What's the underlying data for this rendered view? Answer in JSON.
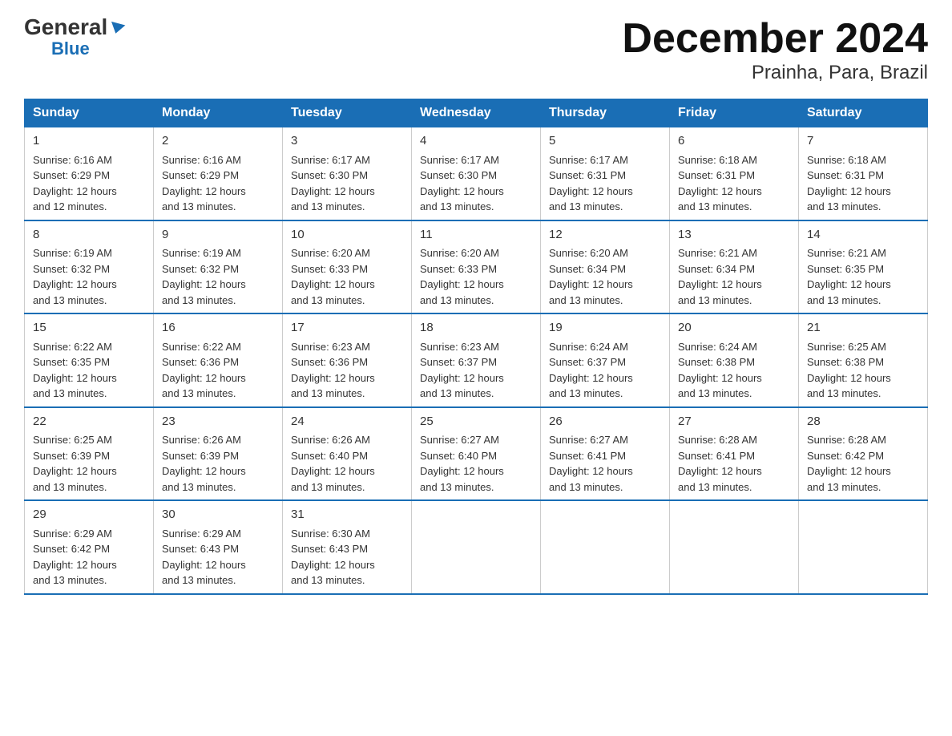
{
  "logo": {
    "general": "General",
    "blue": "Blue",
    "triangle": "▶"
  },
  "title": "December 2024",
  "subtitle": "Prainha, Para, Brazil",
  "weekdays": [
    "Sunday",
    "Monday",
    "Tuesday",
    "Wednesday",
    "Thursday",
    "Friday",
    "Saturday"
  ],
  "weeks": [
    [
      {
        "day": "1",
        "sunrise": "6:16 AM",
        "sunset": "6:29 PM",
        "daylight": "12 hours and 12 minutes."
      },
      {
        "day": "2",
        "sunrise": "6:16 AM",
        "sunset": "6:29 PM",
        "daylight": "12 hours and 13 minutes."
      },
      {
        "day": "3",
        "sunrise": "6:17 AM",
        "sunset": "6:30 PM",
        "daylight": "12 hours and 13 minutes."
      },
      {
        "day": "4",
        "sunrise": "6:17 AM",
        "sunset": "6:30 PM",
        "daylight": "12 hours and 13 minutes."
      },
      {
        "day": "5",
        "sunrise": "6:17 AM",
        "sunset": "6:31 PM",
        "daylight": "12 hours and 13 minutes."
      },
      {
        "day": "6",
        "sunrise": "6:18 AM",
        "sunset": "6:31 PM",
        "daylight": "12 hours and 13 minutes."
      },
      {
        "day": "7",
        "sunrise": "6:18 AM",
        "sunset": "6:31 PM",
        "daylight": "12 hours and 13 minutes."
      }
    ],
    [
      {
        "day": "8",
        "sunrise": "6:19 AM",
        "sunset": "6:32 PM",
        "daylight": "12 hours and 13 minutes."
      },
      {
        "day": "9",
        "sunrise": "6:19 AM",
        "sunset": "6:32 PM",
        "daylight": "12 hours and 13 minutes."
      },
      {
        "day": "10",
        "sunrise": "6:20 AM",
        "sunset": "6:33 PM",
        "daylight": "12 hours and 13 minutes."
      },
      {
        "day": "11",
        "sunrise": "6:20 AM",
        "sunset": "6:33 PM",
        "daylight": "12 hours and 13 minutes."
      },
      {
        "day": "12",
        "sunrise": "6:20 AM",
        "sunset": "6:34 PM",
        "daylight": "12 hours and 13 minutes."
      },
      {
        "day": "13",
        "sunrise": "6:21 AM",
        "sunset": "6:34 PM",
        "daylight": "12 hours and 13 minutes."
      },
      {
        "day": "14",
        "sunrise": "6:21 AM",
        "sunset": "6:35 PM",
        "daylight": "12 hours and 13 minutes."
      }
    ],
    [
      {
        "day": "15",
        "sunrise": "6:22 AM",
        "sunset": "6:35 PM",
        "daylight": "12 hours and 13 minutes."
      },
      {
        "day": "16",
        "sunrise": "6:22 AM",
        "sunset": "6:36 PM",
        "daylight": "12 hours and 13 minutes."
      },
      {
        "day": "17",
        "sunrise": "6:23 AM",
        "sunset": "6:36 PM",
        "daylight": "12 hours and 13 minutes."
      },
      {
        "day": "18",
        "sunrise": "6:23 AM",
        "sunset": "6:37 PM",
        "daylight": "12 hours and 13 minutes."
      },
      {
        "day": "19",
        "sunrise": "6:24 AM",
        "sunset": "6:37 PM",
        "daylight": "12 hours and 13 minutes."
      },
      {
        "day": "20",
        "sunrise": "6:24 AM",
        "sunset": "6:38 PM",
        "daylight": "12 hours and 13 minutes."
      },
      {
        "day": "21",
        "sunrise": "6:25 AM",
        "sunset": "6:38 PM",
        "daylight": "12 hours and 13 minutes."
      }
    ],
    [
      {
        "day": "22",
        "sunrise": "6:25 AM",
        "sunset": "6:39 PM",
        "daylight": "12 hours and 13 minutes."
      },
      {
        "day": "23",
        "sunrise": "6:26 AM",
        "sunset": "6:39 PM",
        "daylight": "12 hours and 13 minutes."
      },
      {
        "day": "24",
        "sunrise": "6:26 AM",
        "sunset": "6:40 PM",
        "daylight": "12 hours and 13 minutes."
      },
      {
        "day": "25",
        "sunrise": "6:27 AM",
        "sunset": "6:40 PM",
        "daylight": "12 hours and 13 minutes."
      },
      {
        "day": "26",
        "sunrise": "6:27 AM",
        "sunset": "6:41 PM",
        "daylight": "12 hours and 13 minutes."
      },
      {
        "day": "27",
        "sunrise": "6:28 AM",
        "sunset": "6:41 PM",
        "daylight": "12 hours and 13 minutes."
      },
      {
        "day": "28",
        "sunrise": "6:28 AM",
        "sunset": "6:42 PM",
        "daylight": "12 hours and 13 minutes."
      }
    ],
    [
      {
        "day": "29",
        "sunrise": "6:29 AM",
        "sunset": "6:42 PM",
        "daylight": "12 hours and 13 minutes."
      },
      {
        "day": "30",
        "sunrise": "6:29 AM",
        "sunset": "6:43 PM",
        "daylight": "12 hours and 13 minutes."
      },
      {
        "day": "31",
        "sunrise": "6:30 AM",
        "sunset": "6:43 PM",
        "daylight": "12 hours and 13 minutes."
      },
      null,
      null,
      null,
      null
    ]
  ],
  "labels": {
    "sunrise": "Sunrise:",
    "sunset": "Sunset:",
    "daylight": "Daylight:"
  }
}
